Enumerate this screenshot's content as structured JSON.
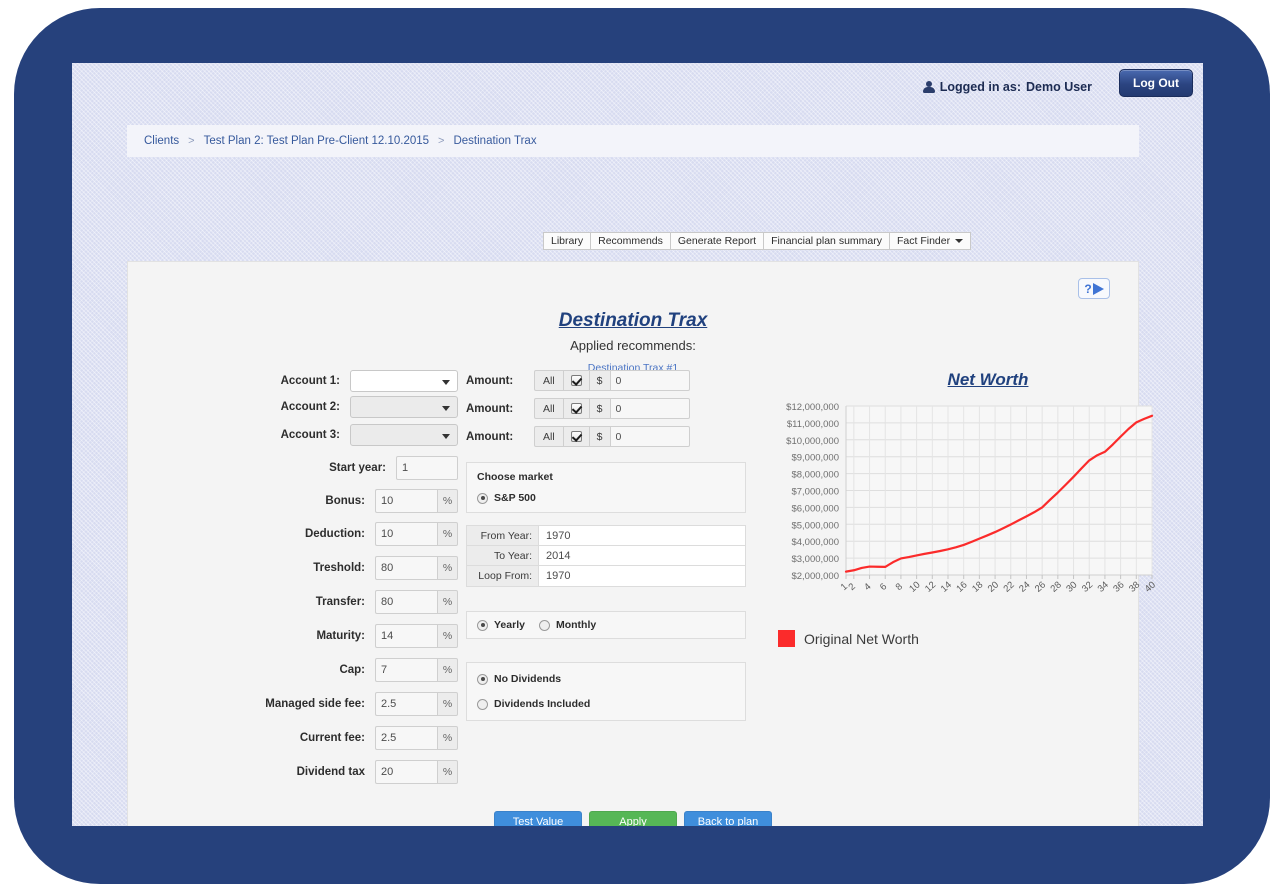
{
  "header": {
    "logged_in_label": "Logged in as:",
    "user_name": "Demo User",
    "logout_label": "Log Out"
  },
  "breadcrumb": {
    "sep": ">",
    "items": [
      "Clients",
      "Test Plan 2: Test Plan Pre-Client 12.10.2015",
      "Destination Trax"
    ]
  },
  "tabs": [
    {
      "label": "Library"
    },
    {
      "label": "Recommends"
    },
    {
      "label": "Generate Report"
    },
    {
      "label": "Financial plan summary"
    },
    {
      "label": "Fact Finder"
    }
  ],
  "help": {
    "question": "?"
  },
  "page": {
    "title": "Destination Trax",
    "applied_label": "Applied recommends:",
    "applied_item": "Destination Trax #1"
  },
  "accounts": [
    {
      "label": "Account 1:",
      "value": "",
      "disabled": false
    },
    {
      "label": "Account 2:",
      "value": "",
      "disabled": true
    },
    {
      "label": "Account 3:",
      "value": "",
      "disabled": true
    }
  ],
  "amounts": [
    {
      "label": "Amount:",
      "all_label": "All",
      "checked": true,
      "currency": "$",
      "value": "0"
    },
    {
      "label": "Amount:",
      "all_label": "All",
      "checked": true,
      "currency": "$",
      "value": "0"
    },
    {
      "label": "Amount:",
      "all_label": "All",
      "checked": true,
      "currency": "$",
      "value": "0"
    }
  ],
  "fields": [
    {
      "label": "Start year:",
      "value": "1",
      "suffix": ""
    },
    {
      "label": "Bonus:",
      "value": "10",
      "suffix": "%"
    },
    {
      "label": "Deduction:",
      "value": "10",
      "suffix": "%"
    },
    {
      "label": "Treshold:",
      "value": "80",
      "suffix": "%"
    },
    {
      "label": "Transfer:",
      "value": "80",
      "suffix": "%"
    },
    {
      "label": "Maturity:",
      "value": "14",
      "suffix": "%"
    },
    {
      "label": "Cap:",
      "value": "7",
      "suffix": "%"
    },
    {
      "label": "Managed side fee:",
      "value": "2.5",
      "suffix": "%"
    },
    {
      "label": "Current fee:",
      "value": "2.5",
      "suffix": "%"
    },
    {
      "label": "Dividend tax",
      "value": "20",
      "suffix": "%"
    }
  ],
  "market": {
    "box_title": "Choose market",
    "option_label": "S&P 500",
    "selected": true
  },
  "years": [
    {
      "label": "From Year:",
      "value": "1970"
    },
    {
      "label": "To Year:",
      "value": "2014"
    },
    {
      "label": "Loop From:",
      "value": "1970"
    }
  ],
  "frequency": {
    "options": [
      {
        "label": "Yearly",
        "selected": true
      },
      {
        "label": "Monthly",
        "selected": false
      }
    ]
  },
  "dividends": {
    "options": [
      {
        "label": "No Dividends",
        "selected": true
      },
      {
        "label": "Dividends Included",
        "selected": false
      }
    ]
  },
  "buttons": [
    {
      "label": "Test Value",
      "style": "blue"
    },
    {
      "label": "Apply",
      "style": "green"
    },
    {
      "label": "Back to plan",
      "style": "blue"
    }
  ],
  "colors": {
    "bezel": "#26417c",
    "window": "#d7dbf0",
    "accent_blue": "#3f8edc",
    "accent_green": "#56b756",
    "series_red": "#fb2b2b",
    "title_navy": "#20417e"
  },
  "chart_data": {
    "type": "line",
    "title": "Net Worth",
    "xlabel": "",
    "ylabel": "",
    "grid": true,
    "legend_position": "below-left",
    "ylim": [
      2000000,
      12000000
    ],
    "ytick_labels": [
      "$12,000,000",
      "$11,000,000",
      "$10,000,000",
      "$9,000,000",
      "$8,000,000",
      "$7,000,000",
      "$6,000,000",
      "$5,000,000",
      "$4,000,000",
      "$3,000,000",
      "$2,000,000"
    ],
    "yticks": [
      12000000,
      11000000,
      10000000,
      9000000,
      8000000,
      7000000,
      6000000,
      5000000,
      4000000,
      3000000,
      2000000
    ],
    "xtick_labels": [
      "1",
      "2",
      "4",
      "6",
      "8",
      "10",
      "12",
      "14",
      "16",
      "18",
      "20",
      "22",
      "24",
      "26",
      "28",
      "30",
      "32",
      "34",
      "36",
      "38",
      "40"
    ],
    "xlim": [
      1,
      40
    ],
    "series": [
      {
        "name": "Original Net Worth",
        "color": "#fb2b2b",
        "x": [
          1,
          2,
          3,
          4,
          5,
          6,
          7,
          8,
          9,
          10,
          11,
          12,
          13,
          14,
          15,
          16,
          17,
          18,
          19,
          20,
          21,
          22,
          23,
          24,
          25,
          26,
          27,
          28,
          29,
          30,
          31,
          32,
          33,
          34,
          35,
          36,
          37,
          38,
          39,
          40
        ],
        "values": [
          2200000,
          2280000,
          2420000,
          2500000,
          2490000,
          2480000,
          2760000,
          2980000,
          3060000,
          3160000,
          3250000,
          3330000,
          3420000,
          3520000,
          3640000,
          3780000,
          3960000,
          4150000,
          4340000,
          4540000,
          4760000,
          4990000,
          5230000,
          5470000,
          5720000,
          6000000,
          6450000,
          6880000,
          7340000,
          7810000,
          8300000,
          8780000,
          9080000,
          9290000,
          9720000,
          10190000,
          10640000,
          11030000,
          11240000,
          11420000
        ]
      }
    ],
    "legend": [
      {
        "label": "Original Net Worth",
        "color": "#fb2b2b"
      }
    ]
  }
}
